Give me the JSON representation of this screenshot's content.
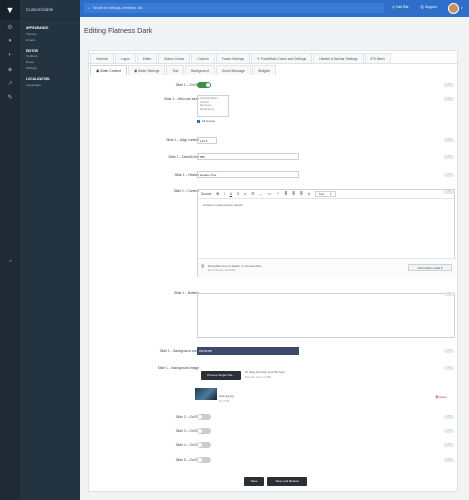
{
  "sidebar": {
    "brand": "Customizable",
    "sections": [
      {
        "title": "APPEARANCE",
        "items": [
          "Themes",
          "Emails"
        ]
      },
      {
        "title": "EDITOR",
        "items": [
          "Toolbars",
          "Emoji",
          "Settings"
        ]
      },
      {
        "title": "LOCALIZATION",
        "items": [
          "Languages"
        ]
      }
    ]
  },
  "topbar": {
    "search_placeholder": "Search for settings, members, etc.",
    "visit_site": "Visit Site",
    "support": "Support"
  },
  "page": {
    "title": "Editing Flatness Dark"
  },
  "tabs_primary": [
    "General",
    "Logos",
    "Editor",
    "Button Colors",
    "Custom",
    "Footer Settings",
    "Front/Main Colors and Settings",
    "Header & Navbar Settings",
    "IPS Menu"
  ],
  "tabs_secondary": [
    "Slider Content",
    "Slider Settings",
    "Text",
    "Background",
    "Guest Message",
    "Widgets"
  ],
  "fields": {
    "slide1_onoff": {
      "label": "Slide 1 – On/Off",
      "on": true
    },
    "slide1_who": {
      "label": "Slide 1 – Who can see?",
      "options": [
        "Administrators",
        "Guests",
        "Members",
        "Moderators"
      ],
      "all_groups": "All Groups"
    },
    "slide1_align": {
      "label": "Slide 1 – Align content",
      "value": "Left"
    },
    "slide1_font": {
      "label": "Slide 1 – Default font",
      "value": "ffffff"
    },
    "slide1_header": {
      "label": "Slide 1 – Header",
      "value": "Header One"
    },
    "slide1_content": {
      "label": "Slide 1 – Content",
      "toolbar": [
        "Source",
        "B",
        "I",
        "U",
        "S",
        "≡",
        "☰",
        "↔",
        "<>",
        "⚐",
        "≣",
        "≣",
        "≣",
        "A",
        "Size"
      ],
      "body": "Custom content lorem ipsum.",
      "drop_text": "Drag files here to attach, or choose files...",
      "drop_sub": "Max total size 40.12MB",
      "insert_label": "Insert other media ▾"
    },
    "slide1_buttons": {
      "label": "Slide 1 – Buttons"
    },
    "slide1_bgcolor": {
      "label": "Slide 1 – Background color",
      "value": "#3D3F6B"
    },
    "slide1_bgimage": {
      "label": "Slide 1 – Background image",
      "button": "Choose Single File...",
      "or_text": "Or drag and drop your file here",
      "max_size": "Max file size 2.1 MB",
      "file_name": "slide-bg.jpg",
      "file_size": "91.3 KB",
      "delete_label": "Delete"
    },
    "slide2_onoff": {
      "label": "Slide 2 – On/Off",
      "on": false
    },
    "slide3_onoff": {
      "label": "Slide 3 – On/Off",
      "on": false
    },
    "slide4_onoff": {
      "label": "Slide 4 – On/Off",
      "on": false
    },
    "slide5_onoff": {
      "label": "Slide 5 – On/Off",
      "on": false
    }
  },
  "buttons": {
    "save": "Save",
    "save_reload": "Save and Reload"
  },
  "icons": {
    "help": "?"
  }
}
